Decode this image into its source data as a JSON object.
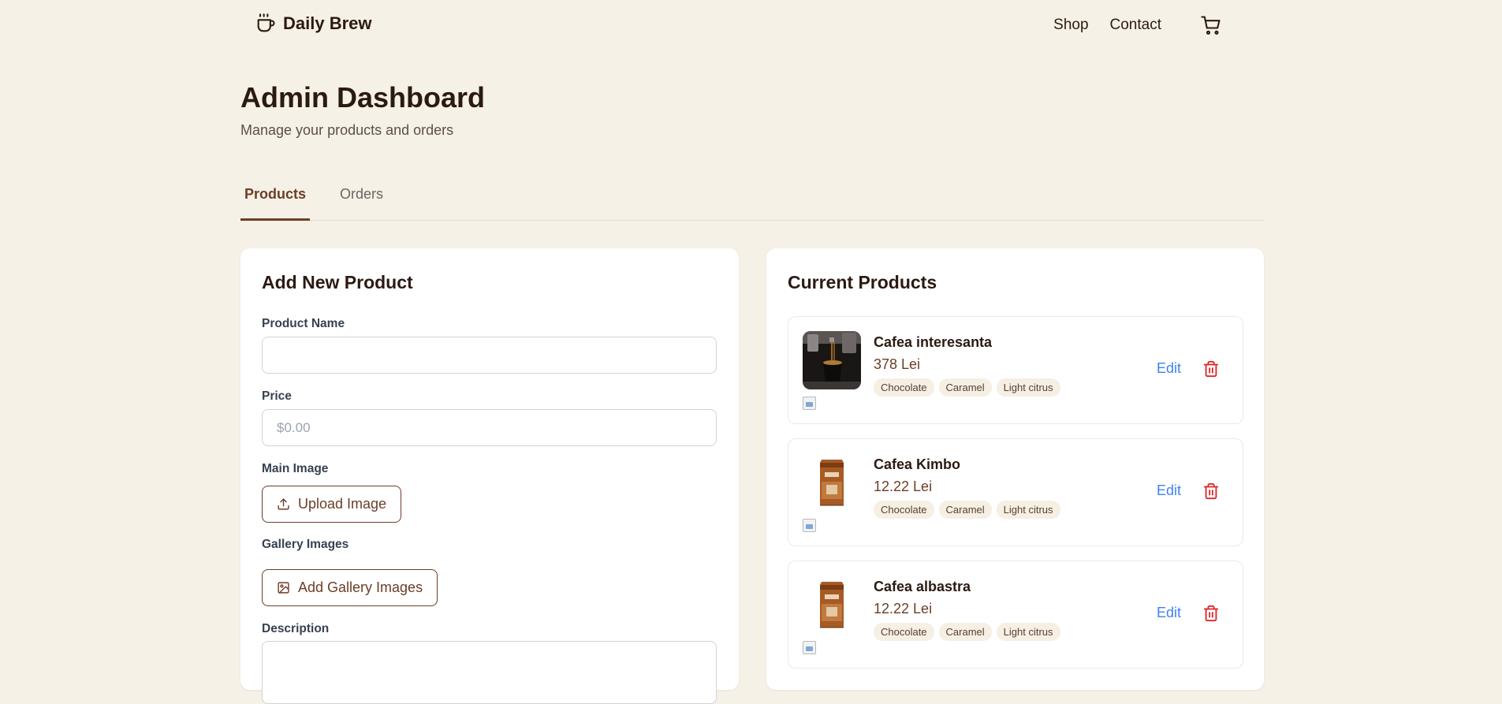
{
  "brand": {
    "name": "Daily Brew",
    "icon": "coffee-cup-icon"
  },
  "nav": {
    "links": [
      "Shop",
      "Contact"
    ],
    "cart_icon": "shopping-cart-icon"
  },
  "header": {
    "title": "Admin Dashboard",
    "subtitle": "Manage your products and orders"
  },
  "tabs": [
    {
      "label": "Products",
      "active": true
    },
    {
      "label": "Orders",
      "active": false
    }
  ],
  "form": {
    "title": "Add New Product",
    "name_label": "Product Name",
    "name_value": "",
    "price_label": "Price",
    "price_placeholder": "$0.00",
    "main_image_label": "Main Image",
    "upload_button": "Upload Image",
    "gallery_label": "Gallery Images",
    "gallery_button": "Add Gallery Images",
    "description_label": "Description"
  },
  "products": {
    "title": "Current Products",
    "edit_label": "Edit",
    "items": [
      {
        "name": "Cafea interesanta",
        "price": "378 Lei",
        "tags": [
          "Chocolate",
          "Caramel",
          "Light citrus"
        ],
        "image": "espresso-cup-photo"
      },
      {
        "name": "Cafea Kimbo",
        "price": "12.22 Lei",
        "tags": [
          "Chocolate",
          "Caramel",
          "Light citrus"
        ],
        "image": "coffee-bag-photo"
      },
      {
        "name": "Cafea albastra",
        "price": "12.22 Lei",
        "tags": [
          "Chocolate",
          "Caramel",
          "Light citrus"
        ],
        "image": "coffee-bag-photo"
      }
    ]
  },
  "colors": {
    "background": "#f6f1e7",
    "accent": "#6b3e26",
    "edit": "#3b82f6",
    "delete": "#dc2626",
    "tag_bg": "#f6efe4"
  }
}
